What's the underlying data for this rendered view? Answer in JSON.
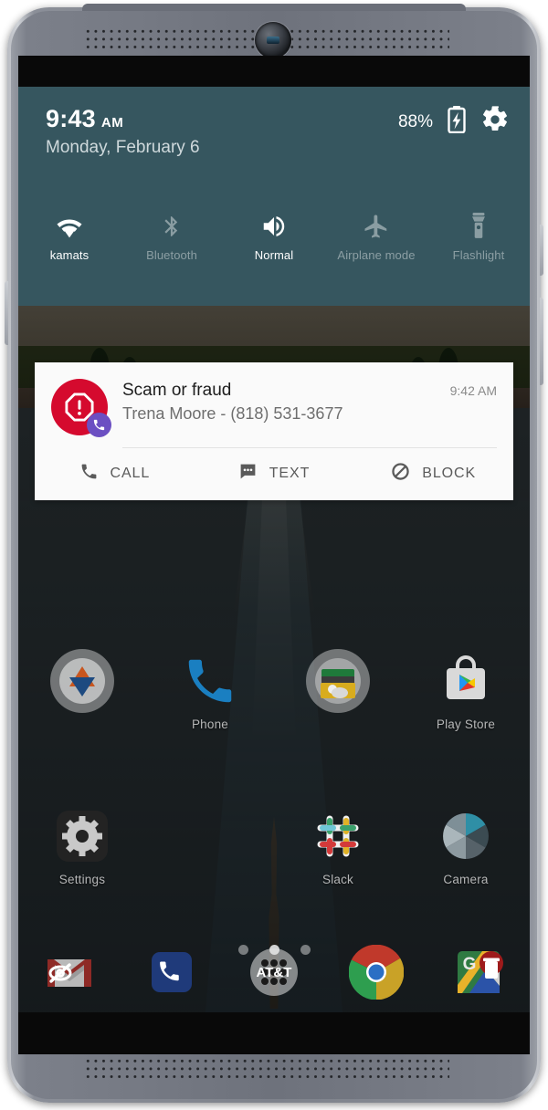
{
  "device": {
    "name": "android-phone-mockup",
    "frame_color": "#7e828b",
    "screen_bg": "#090909"
  },
  "quick_settings": {
    "panel_color": "#36565f",
    "time": "9:43",
    "time_ampm": "AM",
    "date": "Monday, February 6",
    "battery_percent": "88%",
    "battery_icon": "battery-charging-icon",
    "settings_icon": "gear-icon",
    "tiles": [
      {
        "label": "kamats",
        "icon": "wifi-icon",
        "state": "on"
      },
      {
        "label": "Bluetooth",
        "icon": "bluetooth-icon",
        "state": "off"
      },
      {
        "label": "Normal",
        "icon": "volume-up-icon",
        "state": "on"
      },
      {
        "label": "Airplane mode",
        "icon": "airplane-icon",
        "state": "off"
      },
      {
        "label": "Flashlight",
        "icon": "flashlight-icon",
        "state": "off"
      }
    ]
  },
  "notification": {
    "app_icon": "scam-warning-icon",
    "app_icon_color": "#d50a2e",
    "badge_icon": "phone-badge-icon",
    "badge_color": "#6b4fc2",
    "title": "Scam or fraud",
    "subtitle": "Trena  Moore - (818) 531-3677",
    "time": "9:42 AM",
    "actions": [
      {
        "label": "CALL",
        "icon": "phone-icon"
      },
      {
        "label": "TEXT",
        "icon": "message-bubble-icon"
      },
      {
        "label": "BLOCK",
        "icon": "block-icon"
      }
    ]
  },
  "home_screen": {
    "wallpaper_description": "Taj Mahal with reflecting pool",
    "rows": [
      {
        "apps": [
          {
            "label": "",
            "icon": "folder-triangles-icon",
            "label_visible": false
          },
          {
            "label": "Phone",
            "icon": "phone-app-icon",
            "label_visible": true
          },
          {
            "label": "",
            "icon": "folder-weather-icon",
            "label_visible": false
          },
          {
            "label": "Play Store",
            "icon": "play-store-icon",
            "label_visible": true
          }
        ]
      },
      {
        "apps": [
          {
            "label": "Settings",
            "icon": "settings-gear-icon",
            "label_visible": true
          },
          {
            "label": "",
            "icon": "blank-icon",
            "label_visible": false
          },
          {
            "label": "Slack",
            "icon": "slack-icon",
            "label_visible": true
          },
          {
            "label": "Camera",
            "icon": "camera-icon",
            "label_visible": true
          }
        ]
      }
    ],
    "page_dots": {
      "count": 3,
      "active_index": 1
    },
    "dock": [
      {
        "icon": "gmail-icon",
        "overlay": "eye-off-icon"
      },
      {
        "icon": "phone-dock-icon",
        "overlay": ""
      },
      {
        "icon": "app-drawer-icon",
        "overlay": "",
        "label": "AT&T"
      },
      {
        "icon": "chrome-icon",
        "overlay": ""
      },
      {
        "icon": "google-maps-icon",
        "overlay": "trash-icon"
      }
    ]
  }
}
